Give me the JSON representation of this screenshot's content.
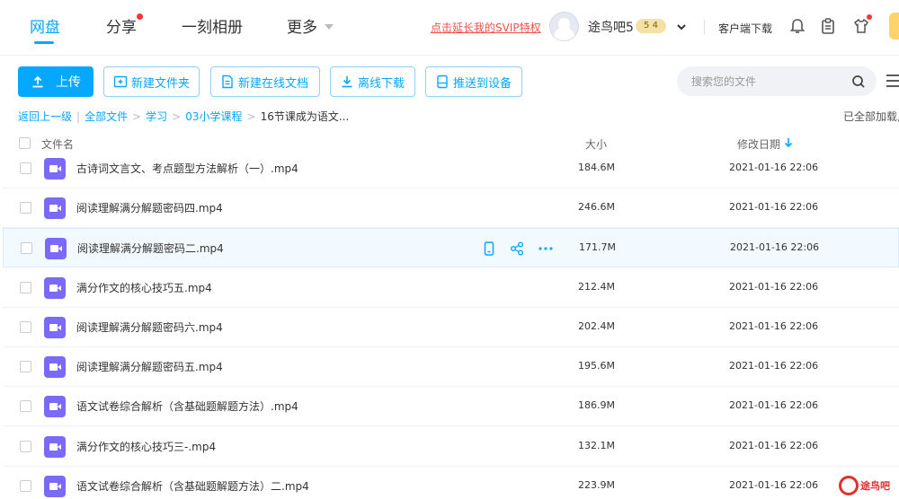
{
  "nav": {
    "tabs": [
      {
        "label": "网盘"
      },
      {
        "label": "分享"
      },
      {
        "label": "一刻相册"
      },
      {
        "label": "更多"
      }
    ],
    "svip_link": "点击延长我的SVIP特权",
    "user": {
      "name": "途鸟吧5",
      "level": "5 4"
    },
    "client_download": "客户端下载"
  },
  "toolbar": {
    "upload": "上传",
    "new_folder": "新建文件夹",
    "new_online_doc": "新建在线文档",
    "offline_download": "离线下载",
    "push_to_device": "推送到设备",
    "search_placeholder": "搜索您的文件"
  },
  "breadcrumb": {
    "back": "返回上一级",
    "items": [
      "全部文件",
      "学习",
      "03小学课程"
    ],
    "current": "16节课成为语文..."
  },
  "load_status": "已全部加载,",
  "columns": {
    "name": "文件名",
    "size": "大小",
    "modified": "修改日期"
  },
  "files": [
    {
      "name": "古诗词文言文、考点题型方法解析（一）.mp4",
      "size": "184.6M",
      "modified": "2021-01-16 22:06"
    },
    {
      "name": "阅读理解满分解题密码四.mp4",
      "size": "246.6M",
      "modified": "2021-01-16 22:06"
    },
    {
      "name": "阅读理解满分解题密码二.mp4",
      "size": "171.7M",
      "modified": "2021-01-16 22:06"
    },
    {
      "name": "满分作文的核心技巧五.mp4",
      "size": "212.4M",
      "modified": "2021-01-16 22:06"
    },
    {
      "name": "阅读理解满分解题密码六.mp4",
      "size": "202.4M",
      "modified": "2021-01-16 22:06"
    },
    {
      "name": "阅读理解满分解题密码五.mp4",
      "size": "195.6M",
      "modified": "2021-01-16 22:06"
    },
    {
      "name": "语文试卷综合解析（含基础题解题方法）.mp4",
      "size": "186.9M",
      "modified": "2021-01-16 22:06"
    },
    {
      "name": "满分作文的核心技巧三-.mp4",
      "size": "132.1M",
      "modified": "2021-01-16 22:06"
    },
    {
      "name": "语文试卷综合解析（含基础题解题方法）二.mp4",
      "size": "223.9M",
      "modified": "2021-01-16 22:06"
    }
  ],
  "watermark": "途鸟吧",
  "colors": {
    "accent": "#06a7ff",
    "svip_red": "#f2504c",
    "video_icon": "#7b6af8"
  }
}
